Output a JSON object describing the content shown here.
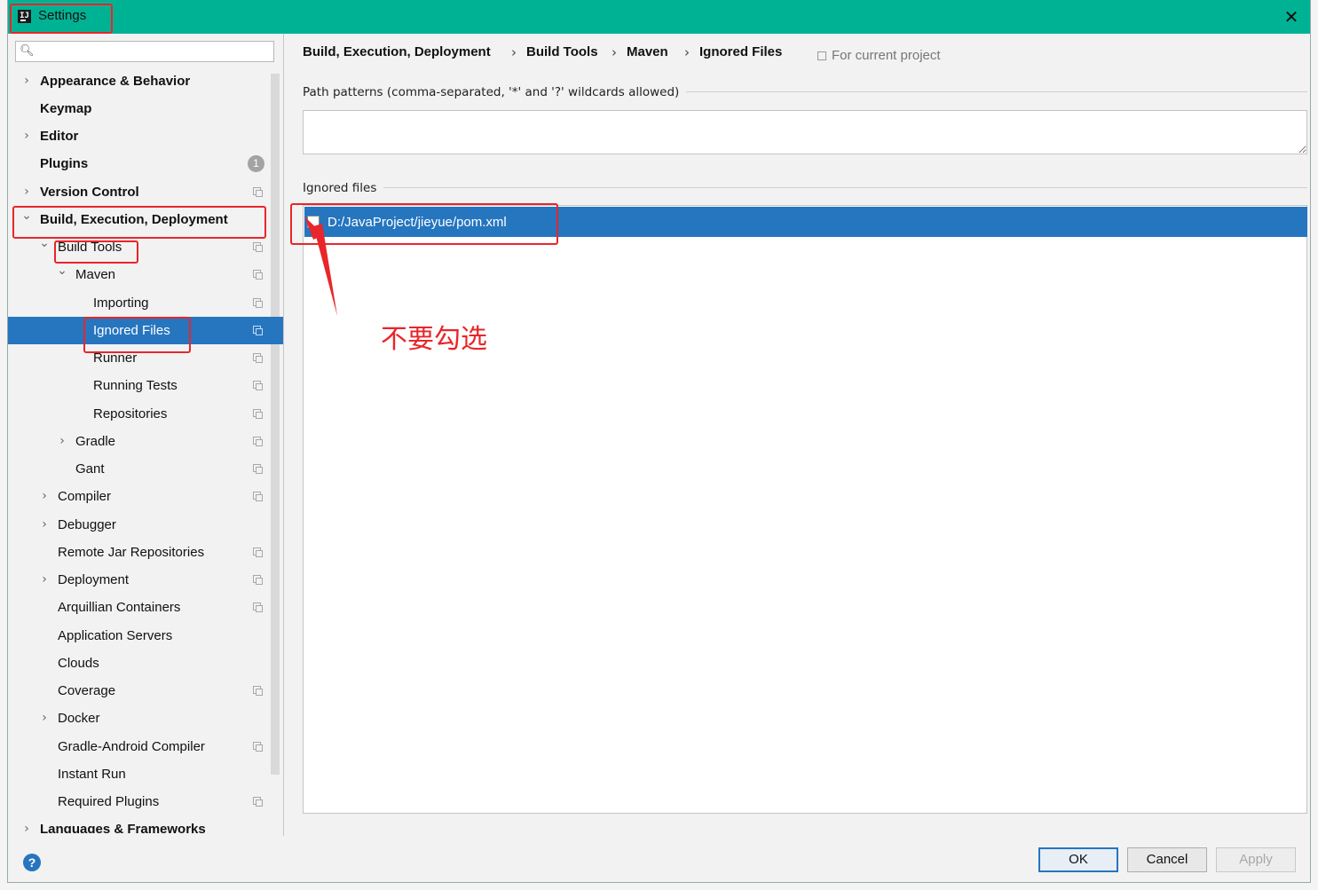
{
  "window": {
    "title": "Settings"
  },
  "search": {
    "placeholder": ""
  },
  "sidebar": {
    "items": [
      {
        "label": "Appearance & Behavior"
      },
      {
        "label": "Keymap"
      },
      {
        "label": "Editor"
      },
      {
        "label": "Plugins",
        "badge": "1"
      },
      {
        "label": "Version Control"
      },
      {
        "label": "Build, Execution, Deployment"
      },
      {
        "label": "Build Tools"
      },
      {
        "label": "Maven"
      },
      {
        "label": "Importing"
      },
      {
        "label": "Ignored Files",
        "selected": true
      },
      {
        "label": "Runner"
      },
      {
        "label": "Running Tests"
      },
      {
        "label": "Repositories"
      },
      {
        "label": "Gradle"
      },
      {
        "label": "Gant"
      },
      {
        "label": "Compiler"
      },
      {
        "label": "Debugger"
      },
      {
        "label": "Remote Jar Repositories"
      },
      {
        "label": "Deployment"
      },
      {
        "label": "Arquillian Containers"
      },
      {
        "label": "Application Servers"
      },
      {
        "label": "Clouds"
      },
      {
        "label": "Coverage"
      },
      {
        "label": "Docker"
      },
      {
        "label": "Gradle-Android Compiler"
      },
      {
        "label": "Instant Run"
      },
      {
        "label": "Required Plugins"
      },
      {
        "label": "Languages & Frameworks"
      }
    ]
  },
  "breadcrumb": {
    "items": [
      "Build, Execution, Deployment",
      "Build Tools",
      "Maven",
      "Ignored Files"
    ],
    "separator": "›",
    "scope": "For current project"
  },
  "main": {
    "patterns_label": "Path patterns (comma-separated, '*' and '?' wildcards allowed)",
    "patterns_value": "",
    "ignored_label": "Ignored files",
    "ignored_files": [
      {
        "path": "D:/JavaProject/jieyue/pom.xml",
        "checked": false
      }
    ]
  },
  "annotation": {
    "callout": "不要勾选",
    "color": "#e8262b"
  },
  "footer": {
    "help": "?",
    "ok": "OK",
    "cancel": "Cancel",
    "apply": "Apply"
  },
  "colors": {
    "titlebar": "#00b294",
    "selection": "#2675bf"
  }
}
